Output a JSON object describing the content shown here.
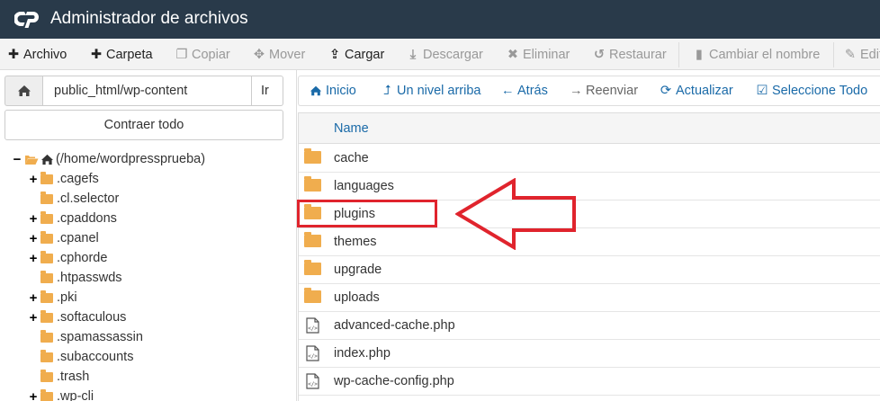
{
  "app": {
    "title": "Administrador de archivos",
    "logo": "cpanel-logo"
  },
  "toolbar": {
    "items": [
      {
        "label": "Archivo",
        "icon": "plus-icon",
        "enabled": true
      },
      {
        "label": "Carpeta",
        "icon": "plus-icon",
        "enabled": true
      },
      {
        "label": "Copiar",
        "icon": "copy-icon",
        "enabled": false
      },
      {
        "label": "Mover",
        "icon": "move-icon",
        "enabled": false
      },
      {
        "label": "Cargar",
        "icon": "upload-icon",
        "enabled": true
      },
      {
        "label": "Descargar",
        "icon": "download-icon",
        "enabled": false
      },
      {
        "label": "Eliminar",
        "icon": "close-icon",
        "enabled": false
      },
      {
        "label": "Restaurar",
        "icon": "undo-icon",
        "enabled": false
      },
      {
        "label": "Cambiar el nombre",
        "icon": "file-icon",
        "enabled": false
      },
      {
        "label": "Edit",
        "icon": "pencil-icon",
        "enabled": false
      }
    ]
  },
  "path_bar": {
    "value": "public_html/wp-content",
    "go_label": "Ir"
  },
  "sidebar": {
    "collapse_label": "Contraer todo",
    "root": "(/home/wordpressprueba)",
    "items": [
      {
        "label": ".cagefs",
        "expandable": true
      },
      {
        "label": ".cl.selector",
        "expandable": false
      },
      {
        "label": ".cpaddons",
        "expandable": true
      },
      {
        "label": ".cpanel",
        "expandable": true
      },
      {
        "label": ".cphorde",
        "expandable": true
      },
      {
        "label": ".htpasswds",
        "expandable": false
      },
      {
        "label": ".pki",
        "expandable": true
      },
      {
        "label": ".softaculous",
        "expandable": true
      },
      {
        "label": ".spamassassin",
        "expandable": false
      },
      {
        "label": ".subaccounts",
        "expandable": false
      },
      {
        "label": ".trash",
        "expandable": false
      },
      {
        "label": ".wp-cli",
        "expandable": true
      }
    ]
  },
  "nav": {
    "home": "Inicio",
    "up": "Un nivel arriba",
    "back": "Atrás",
    "forward": "Reenviar",
    "refresh": "Actualizar",
    "select_all": "Seleccione Todo"
  },
  "file_list": {
    "header_name": "Name",
    "rows": [
      {
        "name": "cache",
        "type": "folder"
      },
      {
        "name": "languages",
        "type": "folder"
      },
      {
        "name": "plugins",
        "type": "folder",
        "highlighted": true
      },
      {
        "name": "themes",
        "type": "folder"
      },
      {
        "name": "upgrade",
        "type": "folder"
      },
      {
        "name": "uploads",
        "type": "folder"
      },
      {
        "name": "advanced-cache.php",
        "type": "php"
      },
      {
        "name": "index.php",
        "type": "php"
      },
      {
        "name": "wp-cache-config.php",
        "type": "php"
      }
    ]
  },
  "colors": {
    "titlebar": "#293a4a",
    "folder": "#f0ad4e",
    "link": "#1a6aa8",
    "annotation": "#e0242d"
  }
}
